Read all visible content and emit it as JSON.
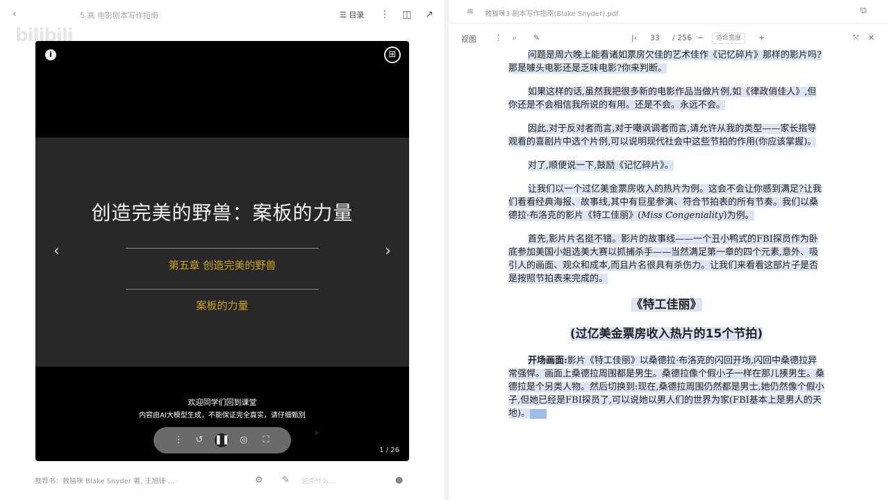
{
  "left": {
    "back_icon": "chevron-left-icon",
    "title": "5.高 电影剧本写作指南",
    "catalog_label": "目录",
    "watermark": "bilibili",
    "video": {
      "title": "创造完美的野兽：案板的力量",
      "sub1": "第五章 创造完美的野兽",
      "sub2": "案板的力量",
      "caption1": "欢迎同学们回到课堂",
      "caption2": "内容由AI大模型生成，不能保证完全真实，请仔细甄别",
      "page": "1 / 26"
    },
    "bottom_text": "推荐书：救猫咪 Blake Snyder 著, 王旭锋 …",
    "input_placeholder": "说点什么…"
  },
  "right": {
    "path": "救猫咪3 剧本写作指南(Blake Snyder).pdf",
    "toolbar": {
      "view": "视图",
      "zoom": "适合宽度",
      "page_a": "33",
      "page_b": "/ 256"
    },
    "doc": {
      "p1": "问题是周六晚上能看诸如票房欠佳的艺术佳作《记忆碎片》那样的影片吗?那是噱头电影还是乏味电影?你来判断。",
      "p2": "如果这样的话,虽然我把很多新的电影作品当做片例,如《律政俏佳人》,但你还是不会相信我所说的有用。还是不会。永远不会。",
      "p3": "因此,对于反对者而言,对于嘲讽调者而言,请允许从我的类型——家长指导观看的喜剧片中选个片例,可以说明现代社会中这些节拍的作用(你应该掌握)。",
      "p4": "对了,顺便说一下,鼓励《记忆碎片》。",
      "p5a": "让我们以一个过亿美金票房收入的热片为例。这会不会让你感到满足?让我们看看经典海报、故事线,其中有巨星参演、符合节拍表的所有节奏。我们以桑德拉·布洛克的影片《特工佳丽》(",
      "p5_en": "Miss Congeniality",
      "p5b": ")为例。",
      "p6": "首先,影片片名挺不错。影片的故事线——一个丑小鸭式的FBI探员作为卧底参加美国小姐选美大赛以抓捕杀手——当然满足第一章的四个元素,意外、吸引人的画面、观众和成本,而且片名很具有杀伤力。让我们来看看这部片子是否是按照节拍表来完成的。",
      "h1": "《特工佳丽》",
      "h2": "(过亿美金票房收入热片的15个节拍)",
      "p7_label": "开场画面:",
      "p7": "影片《特工佳丽》以桑德拉·布洛克的闪回开场,闪回中桑德拉异常强悍。画面上桑德拉周围都是男生。桑德拉像个假小子一样在那儿揍男生。桑德拉是个另类人物。然后切换到:现在,桑德拉周围仍然都是男士,她仍然像个假小子,但她已经是FBI探员了,可以说她以男人们的世界为家(FBI基本上是男人的天地)。"
    }
  }
}
